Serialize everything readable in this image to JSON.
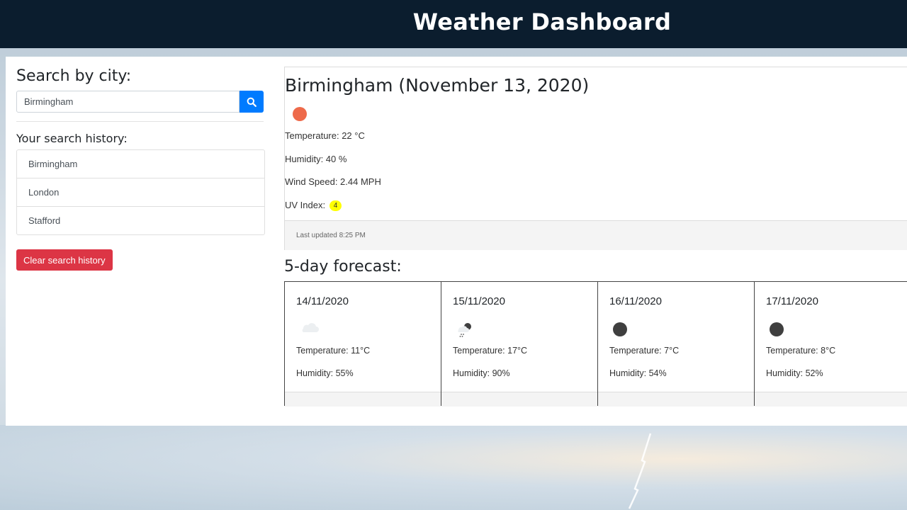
{
  "header": {
    "title": "Weather Dashboard"
  },
  "search": {
    "title": "Search by city:",
    "value": "Birmingham",
    "button_icon": "search-icon"
  },
  "history": {
    "title": "Your search history:",
    "items": [
      "Birmingham",
      "London",
      "Stafford"
    ],
    "clear_label": "Clear search history"
  },
  "current": {
    "title": "Birmingham (November 13, 2020)",
    "icon": "sun-icon",
    "temperature": "Temperature: 22 °C",
    "humidity": "Humidity: 40 %",
    "wind": "Wind Speed: 2.44 MPH",
    "uv_label": "UV Index:",
    "uv_value": "4",
    "updated": "Last updated 8:25 PM"
  },
  "forecast": {
    "title": "5-day forecast:",
    "days": [
      {
        "date": "14/11/2020",
        "icon": "cloud-icon",
        "temp": "Temperature: 11°C",
        "humidity": "Humidity: 55%"
      },
      {
        "date": "15/11/2020",
        "icon": "night-rain-icon",
        "temp": "Temperature: 17°C",
        "humidity": "Humidity: 90%"
      },
      {
        "date": "16/11/2020",
        "icon": "moon-icon",
        "temp": "Temperature: 7°C",
        "humidity": "Humidity: 54%"
      },
      {
        "date": "17/11/2020",
        "icon": "moon-icon",
        "temp": "Temperature: 8°C",
        "humidity": "Humidity: 52%"
      }
    ]
  },
  "colors": {
    "header_bg": "#0b1d2e",
    "primary": "#007bff",
    "danger": "#dc3545",
    "uv_badge": "#ffff00",
    "sun": "#ee6a4a"
  }
}
